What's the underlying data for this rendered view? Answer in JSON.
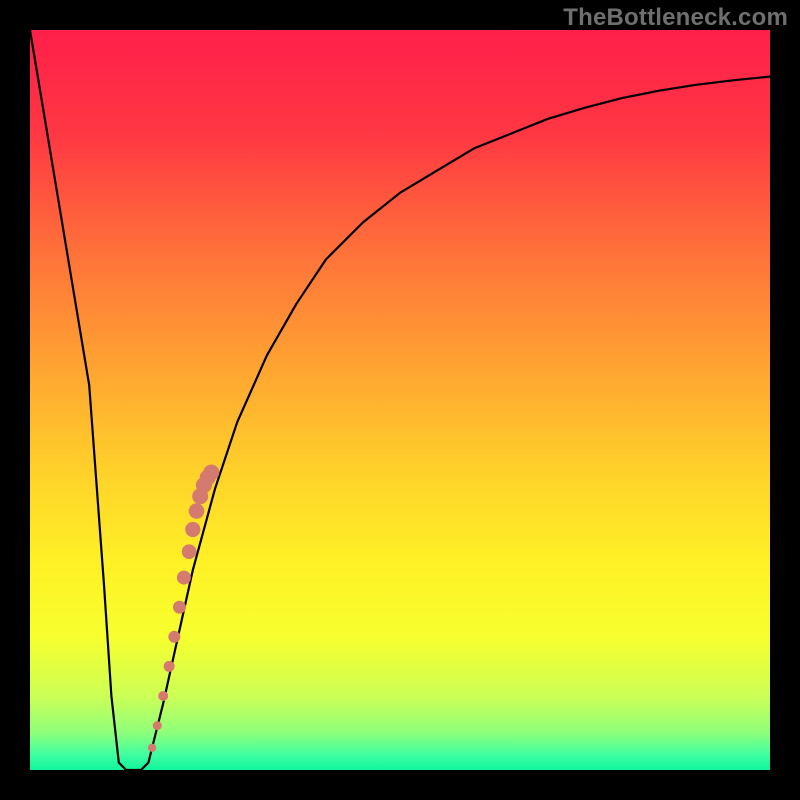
{
  "watermark": "TheBottleneck.com",
  "colors": {
    "frame": "#000000",
    "curve": "#000000",
    "dots": "#d57a6f",
    "watermark": "#6f6f6f"
  },
  "chart_data": {
    "type": "line",
    "title": "",
    "xlabel": "",
    "ylabel": "",
    "ylim": [
      0,
      100
    ],
    "xlim": [
      0,
      100
    ],
    "series": [
      {
        "name": "bottleneck-curve",
        "x": [
          0,
          2,
          4,
          6,
          8,
          10,
          11,
          12,
          13,
          14,
          15,
          16,
          18,
          20,
          22,
          25,
          28,
          32,
          36,
          40,
          45,
          50,
          55,
          60,
          65,
          70,
          75,
          80,
          85,
          90,
          95,
          100
        ],
        "values": [
          100,
          88,
          76,
          64,
          52,
          25,
          10,
          1,
          0,
          0,
          0,
          1,
          9,
          18,
          27,
          38,
          47,
          56,
          63,
          69,
          74,
          78,
          81,
          84,
          86,
          88,
          89.5,
          90.8,
          91.8,
          92.6,
          93.2,
          93.7
        ]
      }
    ],
    "scatter_overlay": {
      "name": "highlight-dots",
      "x": [
        16.5,
        17.2,
        18.0,
        18.8,
        19.5,
        20.2,
        20.8,
        21.5,
        22.0,
        22.5,
        23.0,
        23.5,
        24.0,
        24.5
      ],
      "values": [
        3.0,
        6.0,
        10.0,
        14.0,
        18.0,
        22.0,
        26.0,
        29.5,
        32.5,
        35.0,
        37.0,
        38.5,
        39.5,
        40.2
      ],
      "r": [
        4.2,
        4.5,
        5.0,
        5.5,
        6.0,
        6.5,
        7.0,
        7.3,
        7.6,
        7.8,
        8.0,
        8.0,
        8.0,
        8.0
      ]
    },
    "gradient_stops": [
      {
        "pct": 0,
        "color": "#ff1f4a"
      },
      {
        "pct": 14,
        "color": "#ff3743"
      },
      {
        "pct": 30,
        "color": "#ff713a"
      },
      {
        "pct": 46,
        "color": "#ffa531"
      },
      {
        "pct": 60,
        "color": "#ffd22a"
      },
      {
        "pct": 72,
        "color": "#fff126"
      },
      {
        "pct": 82,
        "color": "#f7ff2e"
      },
      {
        "pct": 90,
        "color": "#ccff55"
      },
      {
        "pct": 95,
        "color": "#8dff7a"
      },
      {
        "pct": 98,
        "color": "#3dffa1"
      },
      {
        "pct": 100,
        "color": "#10f59b"
      }
    ]
  }
}
